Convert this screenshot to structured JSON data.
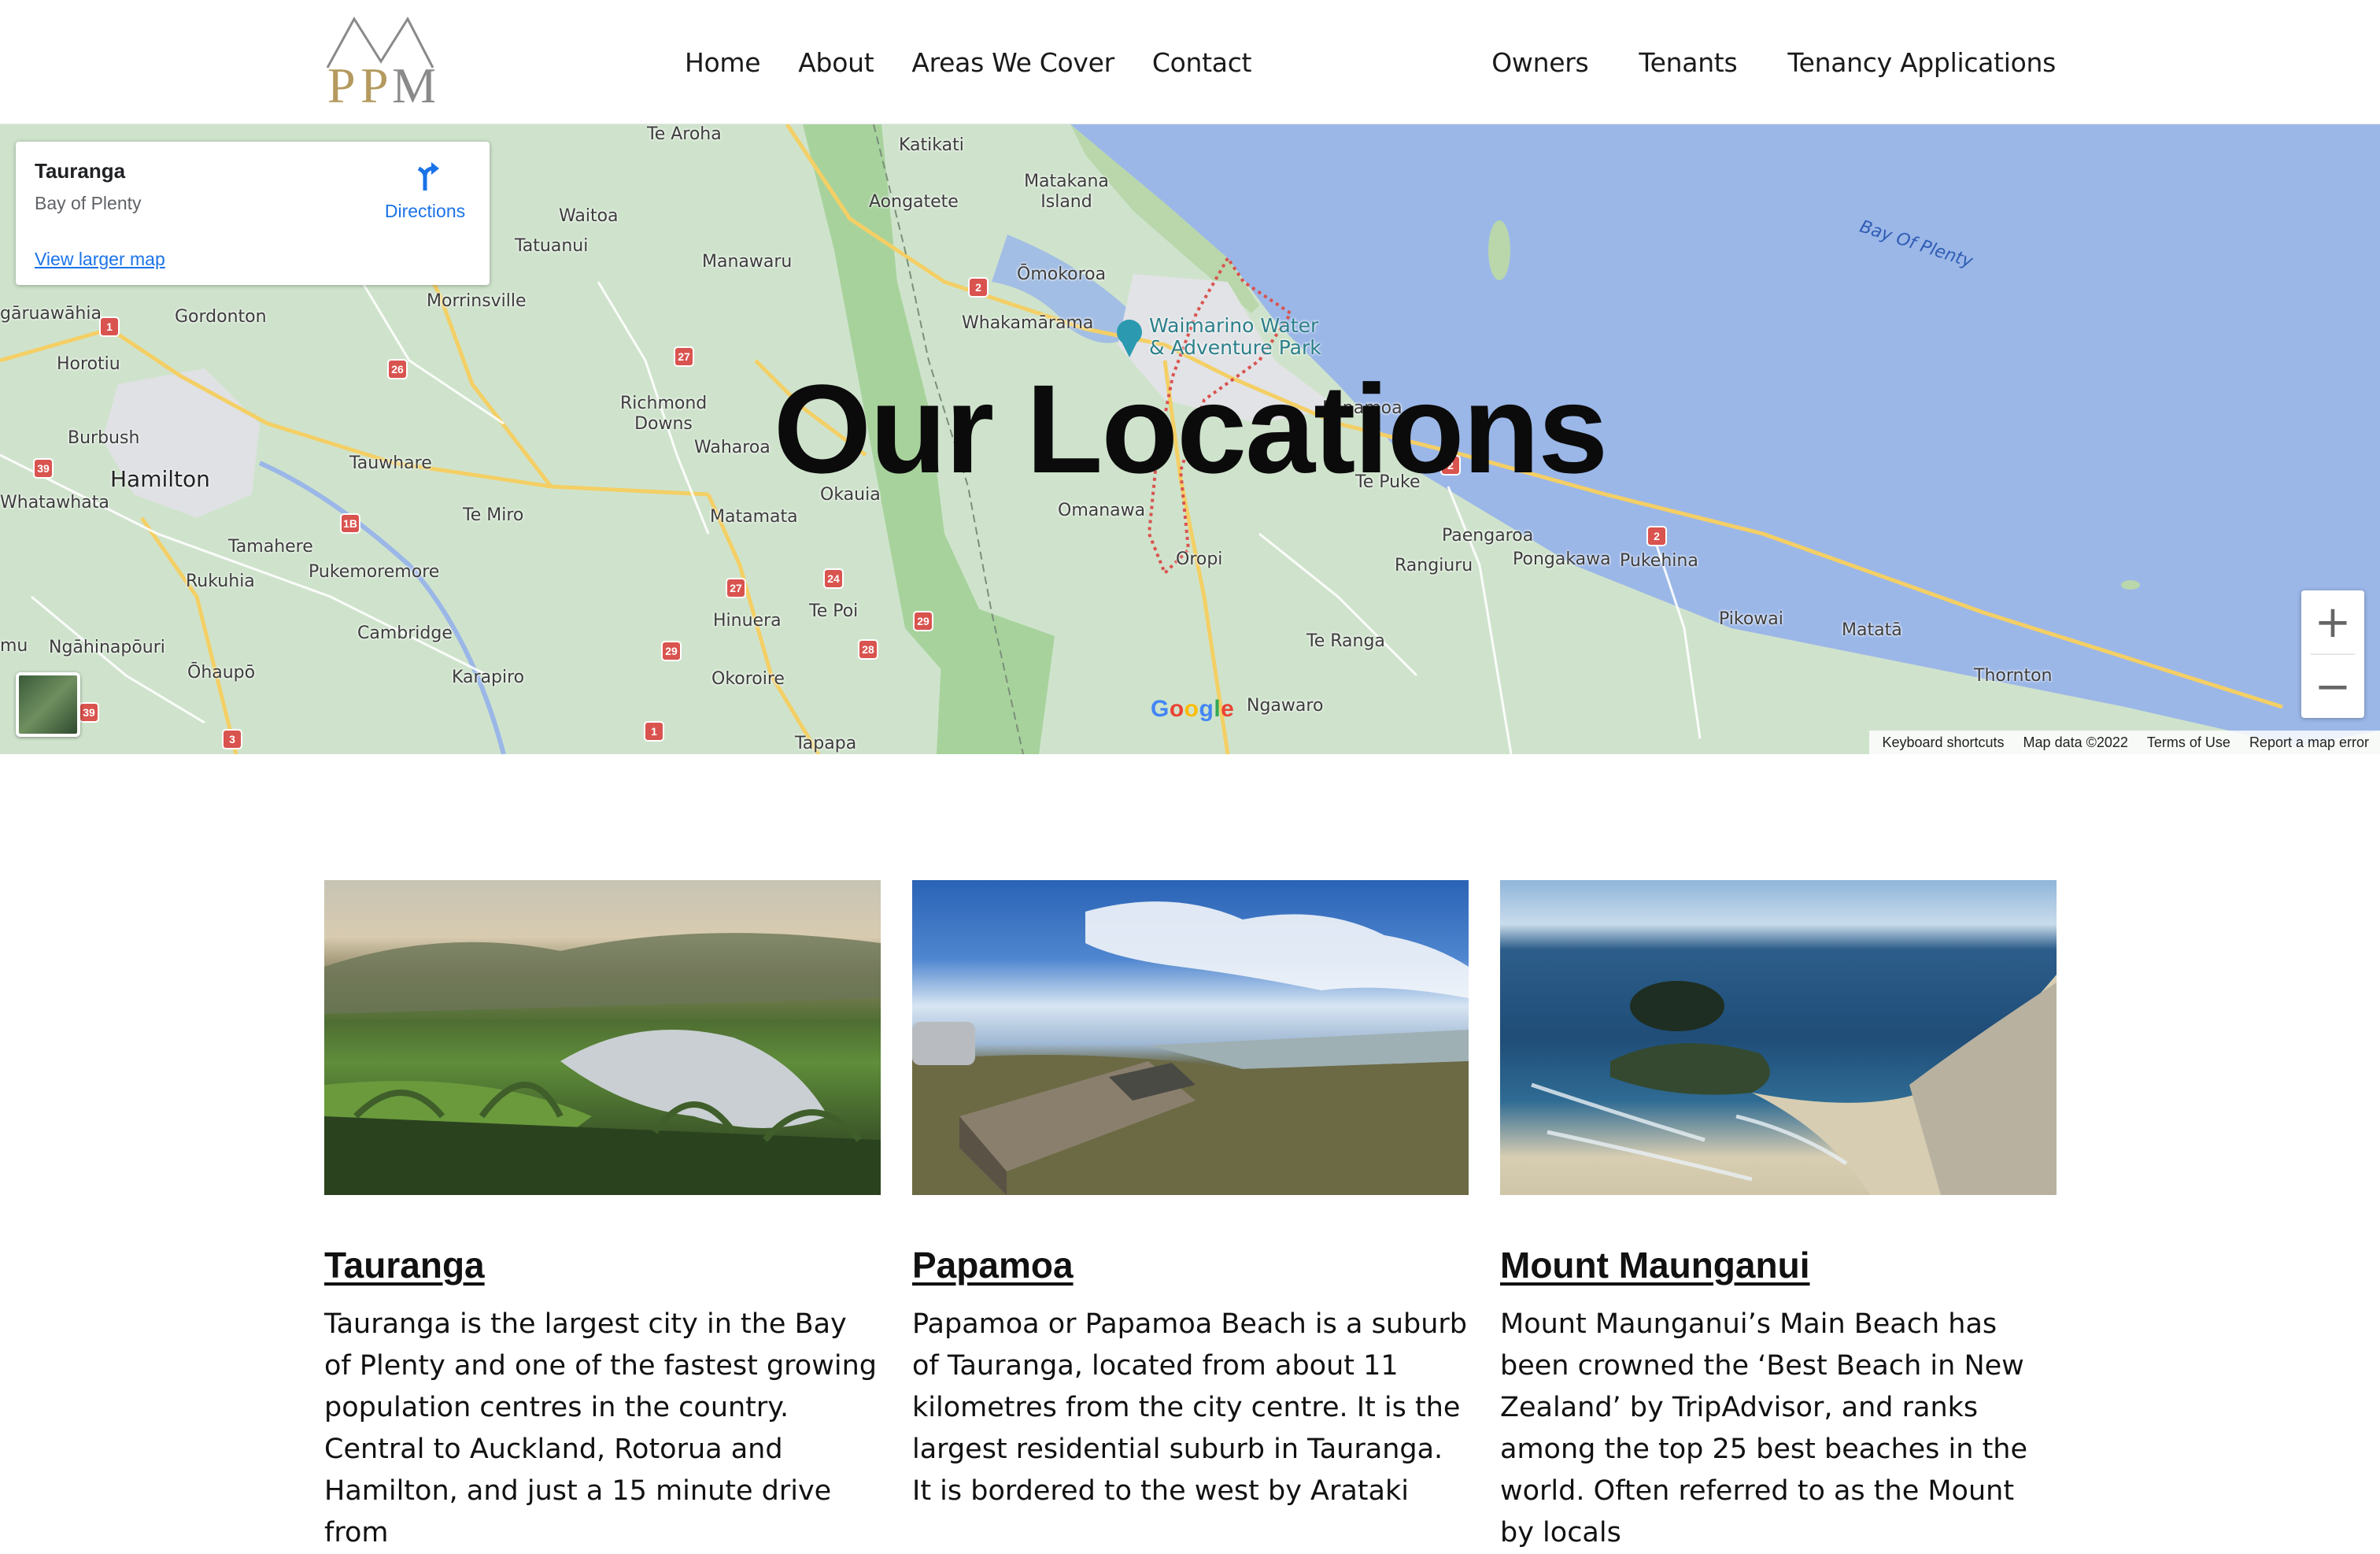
{
  "header": {
    "logo_text": "PPM",
    "nav_main": [
      "Home",
      "About",
      "Areas We Cover",
      "Contact"
    ],
    "nav_right": [
      "Owners",
      "Tenants",
      "Tenancy Applications"
    ]
  },
  "map": {
    "title": "Our Locations",
    "info_card": {
      "name": "Tauranga",
      "region": "Bay of Plenty",
      "directions_label": "Directions",
      "larger_map_label": "View larger map"
    },
    "places": [
      "Te Aroha",
      "Katikati",
      "Matakana Island",
      "Aongatete",
      "Waitoa",
      "Tatuanui",
      "Manawaru",
      "Ōmokoroa",
      "Whakamārama",
      "Waimarino Water & Adventure Park",
      "Morrinsville",
      "Gordonton",
      "gāruawāhia",
      "Horotiu",
      "Burbush",
      "Hamilton",
      "Whatawhata",
      "Tamahere",
      "Tauwhare",
      "Richmond Downs",
      "Waharoa",
      "Okauia",
      "Matamata",
      "Omanawa",
      "Papamoa",
      "Te Puke",
      "Paengaroa",
      "Pongakawa",
      "Pukehina",
      "Rangiuru",
      "Oropi",
      "Te Miro",
      "Rukuhia",
      "Pukemoremore",
      "Cambridge",
      "Ngāhinapōuri",
      "Ōhaupō",
      "Karapiro",
      "Hinuera",
      "Te Poi",
      "Okoroire",
      "Tapapa",
      "Te Ranga",
      "Ngawaro",
      "Pikowai",
      "Matatā",
      "Thornton",
      "Bay Of Plenty",
      "mu"
    ],
    "road_shields": [
      "1",
      "26",
      "27",
      "2",
      "39",
      "1B",
      "27",
      "24",
      "29",
      "29",
      "28",
      "2",
      "39",
      "3",
      "1",
      "2"
    ],
    "zoom_in": "+",
    "zoom_out": "−",
    "google_logo": "Google",
    "attribution": [
      "Keyboard shortcuts",
      "Map data ©2022",
      "Terms of Use",
      "Report a map error"
    ]
  },
  "locations": [
    {
      "name": "Tauranga",
      "text": "Tauranga is the largest city in the Bay of Plenty and one of the fastest growing population centres in the country. Central to Auckland, Rotorua and Hamilton, and just a 15 minute drive from"
    },
    {
      "name": "Papamoa",
      "text": "Papamoa or Papamoa Beach is a suburb of Tauranga, located from about 11 kilometres from the city centre. It is the largest residential suburb in Tauranga. It is bordered to the west by Arataki"
    },
    {
      "name": "Mount Maunganui",
      "text": "Mount Maunganui’s Main Beach has been crowned the ‘Best Beach in New Zealand’ by TripAdvisor, and ranks among the top 25 best beaches in the world. Often referred to as the Mount by locals"
    }
  ],
  "colors": {
    "map_land": "#cfe3cc",
    "map_sea": "#9bb7e8",
    "link_blue": "#1a73e8",
    "road_shield": "#d9534f",
    "logo_gold": "#b49a5e"
  }
}
